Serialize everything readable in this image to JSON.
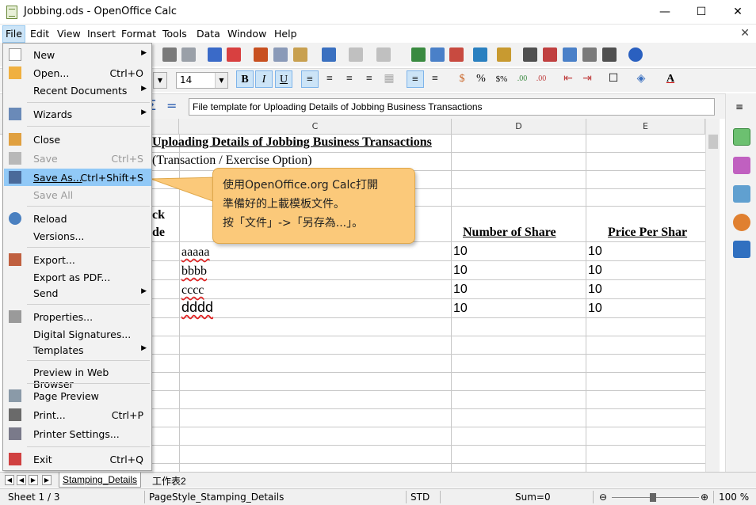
{
  "window": {
    "title": "Jobbing.ods - OpenOffice Calc",
    "min": "—",
    "max": "☐",
    "close": "✕"
  },
  "menubar": {
    "items": [
      "File",
      "Edit",
      "View",
      "Insert",
      "Format",
      "Tools",
      "Data",
      "Window",
      "Help"
    ],
    "close_doc": "✕"
  },
  "toolbar": {
    "font_size": "14"
  },
  "formula": {
    "sigma": "Σ",
    "equals": "=",
    "content": "File template for Uploading Details of Jobbing Business Transactions"
  },
  "columns": [
    "C",
    "D",
    "E"
  ],
  "sheet": {
    "title_row": "Uploading Details of Jobbing Business Transactions",
    "subtitle_row": "(Transaction / Exercise Option)",
    "hdr_partial1": "ck",
    "hdr_partial2": "de",
    "hdr_number": "Number of Share",
    "hdr_price": "Price Per Shar",
    "rows": [
      {
        "c": "aaaaa",
        "d": "10",
        "e": "10"
      },
      {
        "c": "bbbb",
        "d": "10",
        "e": "10"
      },
      {
        "c": "cccc",
        "d": "10",
        "e": "10"
      },
      {
        "c": "dddd",
        "d": "10",
        "e": "10"
      }
    ]
  },
  "file_menu": {
    "new": "New",
    "open": "Open...",
    "open_acc": "Ctrl+O",
    "recent": "Recent Documents",
    "wizards": "Wizards",
    "close": "Close",
    "save": "Save",
    "save_acc": "Ctrl+S",
    "save_as": "Save As...",
    "save_as_acc": "Ctrl+Shift+S",
    "save_all": "Save All",
    "reload": "Reload",
    "versions": "Versions...",
    "export": "Export...",
    "export_pdf": "Export as PDF...",
    "send": "Send",
    "properties": "Properties...",
    "digital_sig": "Digital Signatures...",
    "templates": "Templates",
    "preview_web": "Preview in Web Browser",
    "page_preview": "Page Preview",
    "print": "Print...",
    "print_acc": "Ctrl+P",
    "printer_settings": "Printer Settings...",
    "exit": "Exit",
    "exit_acc": "Ctrl+Q"
  },
  "callout": {
    "line1": "使用OpenOffice.org Calc打開",
    "line2": "準備好的上載模板文件。",
    "line3": "按「文件」->「另存為...」。"
  },
  "tabs": {
    "active": "Stamping_Details",
    "other": "工作表2"
  },
  "status": {
    "sheet": "Sheet 1 / 3",
    "page_style": "PageStyle_Stamping_Details",
    "mode": "STD",
    "sum": "Sum=0",
    "zoom": "100 %"
  },
  "colors": {
    "accent": "#91c9f7",
    "callout": "#fbc97a"
  }
}
